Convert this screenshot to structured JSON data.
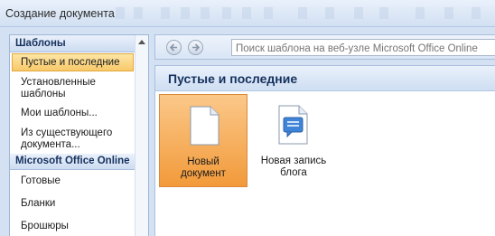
{
  "window": {
    "title": "Создание документа"
  },
  "left_pane": {
    "header": "Шаблоны",
    "items": [
      {
        "label": "Пустые и последние",
        "selected": true
      },
      {
        "label_lines": [
          "Установленные",
          "шаблоны"
        ]
      },
      {
        "label": "Мои шаблоны..."
      },
      {
        "label_lines": [
          "Из существующего",
          "документа..."
        ]
      }
    ],
    "online_header": "Microsoft Office Online",
    "online_items": [
      {
        "label": "Готовые"
      },
      {
        "label": "Бланки"
      },
      {
        "label": "Брошюры"
      }
    ]
  },
  "navbar": {
    "back_icon": "arrow-left-icon",
    "forward_icon": "arrow-right-icon",
    "search_placeholder": "Поиск шаблона на веб-узле Microsoft Office Online"
  },
  "main": {
    "section_title": "Пустые и последние",
    "tiles": [
      {
        "label_lines": [
          "Новый",
          "документ"
        ],
        "icon": "blank-document-icon",
        "selected": true
      },
      {
        "label_lines": [
          "Новая запись",
          "блога"
        ],
        "icon": "blog-post-icon",
        "selected": false
      }
    ]
  },
  "colors": {
    "selection_orange": "#f29a3a",
    "header_navy": "#15315e",
    "frame_blue": "#d3e1f3"
  }
}
